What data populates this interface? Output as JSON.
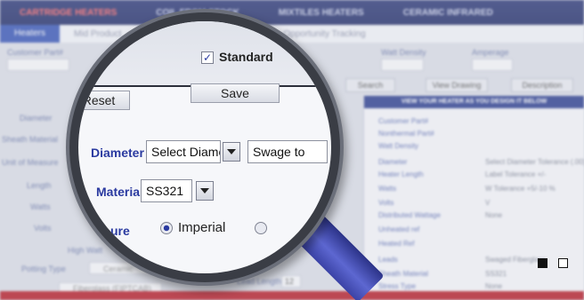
{
  "nav": {
    "tabs": [
      "CARTRIDGE HEATERS",
      "COIL FROM STOCK",
      "MIXTILES HEATERS",
      "CERAMIC INFRARED"
    ]
  },
  "subnav": {
    "items": [
      "Heaters",
      "Mid Product",
      "Opportunity Tracking"
    ]
  },
  "background": {
    "labels": {
      "customer_part": "Customer Part#",
      "watt_density": "Watt Density",
      "amperage": "Amperage",
      "diameter": "Diameter",
      "sheath_material": "Sheath Material",
      "unit_of_measure": "Unit of Measure",
      "length": "Length",
      "watts": "Watts",
      "volts": "Volts",
      "high_watt": "High Watt",
      "potting_type": "Potting Type",
      "lead_length": "Lead Length",
      "lead_length_value": "12",
      "potting_value": "Ceramic",
      "leads_value": "Fiberglass (FIPTCAB)",
      "no_label": "No"
    },
    "buttons": {
      "search": "Search",
      "view_drawing": "View Drawing",
      "description": "Description"
    }
  },
  "right_panel": {
    "header": "VIEW YOUR HEATER AS YOU DESIGN IT BELOW",
    "rows": [
      {
        "label": "Customer Part#",
        "value": ""
      },
      {
        "label": "Nonthermal Part#",
        "value": ""
      },
      {
        "label": "Watt Density",
        "value": ""
      },
      {
        "label": "Diameter",
        "value": "Select Diameter Tolerance (.00)"
      },
      {
        "label": "Heater Length",
        "value": "Label    Tolerance +/-"
      },
      {
        "label": "Watts",
        "value": "W Tolerance +5/-10 %"
      },
      {
        "label": "Volts",
        "value": "V"
      },
      {
        "label": "Distributed Wattage",
        "value": "None"
      },
      {
        "label": "Unheated ref",
        "value": ""
      },
      {
        "label": "Heated Ref",
        "value": ""
      },
      {
        "label": "Leads",
        "value": "Swaged Fiberglass"
      },
      {
        "label": "Sheath Material",
        "value": "SS321"
      },
      {
        "label": "Stress Type",
        "value": "None"
      }
    ]
  },
  "magnifier": {
    "reset_label": "Reset",
    "save_label": "Save",
    "standard_label": "Standard",
    "diameter_label": "Diameter",
    "diameter_value": "Select Diameter",
    "swage_value": "Swage to",
    "material_label": "Material",
    "material_value": "SS321",
    "measure_label": "Measure",
    "imperial_label": "Imperial",
    "measure_partial": "ure"
  },
  "slider": {
    "active_index": 0,
    "count": 2
  },
  "colors": {
    "nav_bg": "#2e3a78",
    "accent": "#2a3aa0",
    "bottom_bar": "#b51f2b",
    "handle": "#3b43a6"
  }
}
